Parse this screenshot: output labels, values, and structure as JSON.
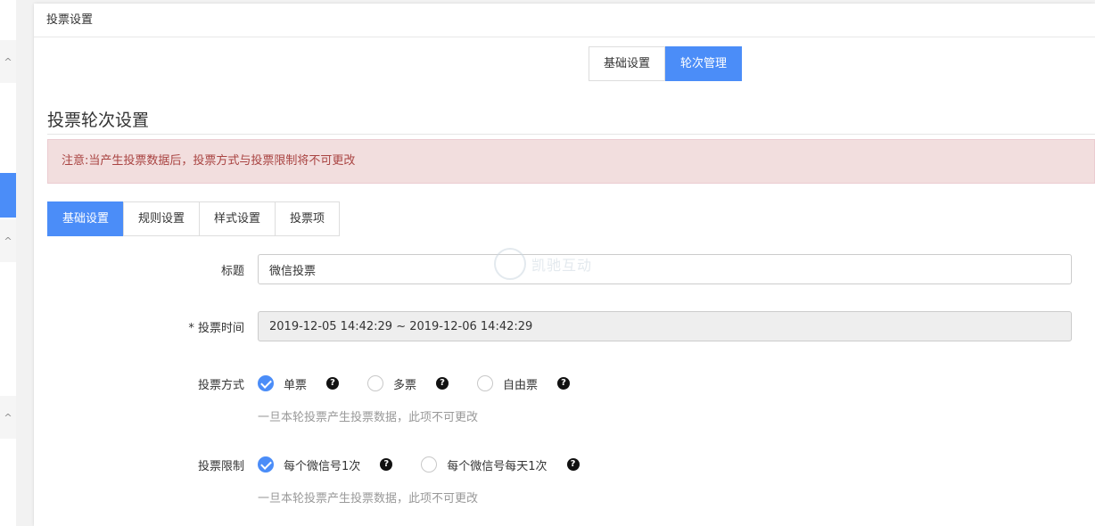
{
  "panel": {
    "title": "投票设置"
  },
  "top_tabs": [
    {
      "label": "基础设置",
      "active": false
    },
    {
      "label": "轮次管理",
      "active": true
    }
  ],
  "section": {
    "title": "投票轮次设置"
  },
  "alert": {
    "text": "注意:当产生投票数据后，投票方式与投票限制将不可更改"
  },
  "sub_tabs": [
    {
      "label": "基础设置",
      "active": true
    },
    {
      "label": "规则设置",
      "active": false
    },
    {
      "label": "样式设置",
      "active": false
    },
    {
      "label": "投票项",
      "active": false
    }
  ],
  "form": {
    "title": {
      "label": "标题",
      "value": "微信投票"
    },
    "vote_time": {
      "label": "* 投票时间",
      "value": "2019-12-05 14:42:29 ~ 2019-12-06 14:42:29"
    },
    "vote_mode": {
      "label": "投票方式",
      "options": [
        {
          "label": "单票",
          "checked": true
        },
        {
          "label": "多票",
          "checked": false
        },
        {
          "label": "自由票",
          "checked": false
        }
      ],
      "hint": "一旦本轮投票产生投票数据，此项不可更改"
    },
    "vote_limit": {
      "label": "投票限制",
      "options": [
        {
          "label": "每个微信号1次",
          "checked": true
        },
        {
          "label": "每个微信号每天1次",
          "checked": false
        }
      ],
      "hint": "一旦本轮投票产生投票数据，此项不可更改"
    }
  },
  "help_glyph": "?",
  "sidebar_chevron": "^",
  "watermark": {
    "text": "凯驰互动"
  },
  "colors": {
    "primary": "#4b8df8",
    "alert_bg": "#f2dede",
    "alert_text": "#a94442"
  }
}
